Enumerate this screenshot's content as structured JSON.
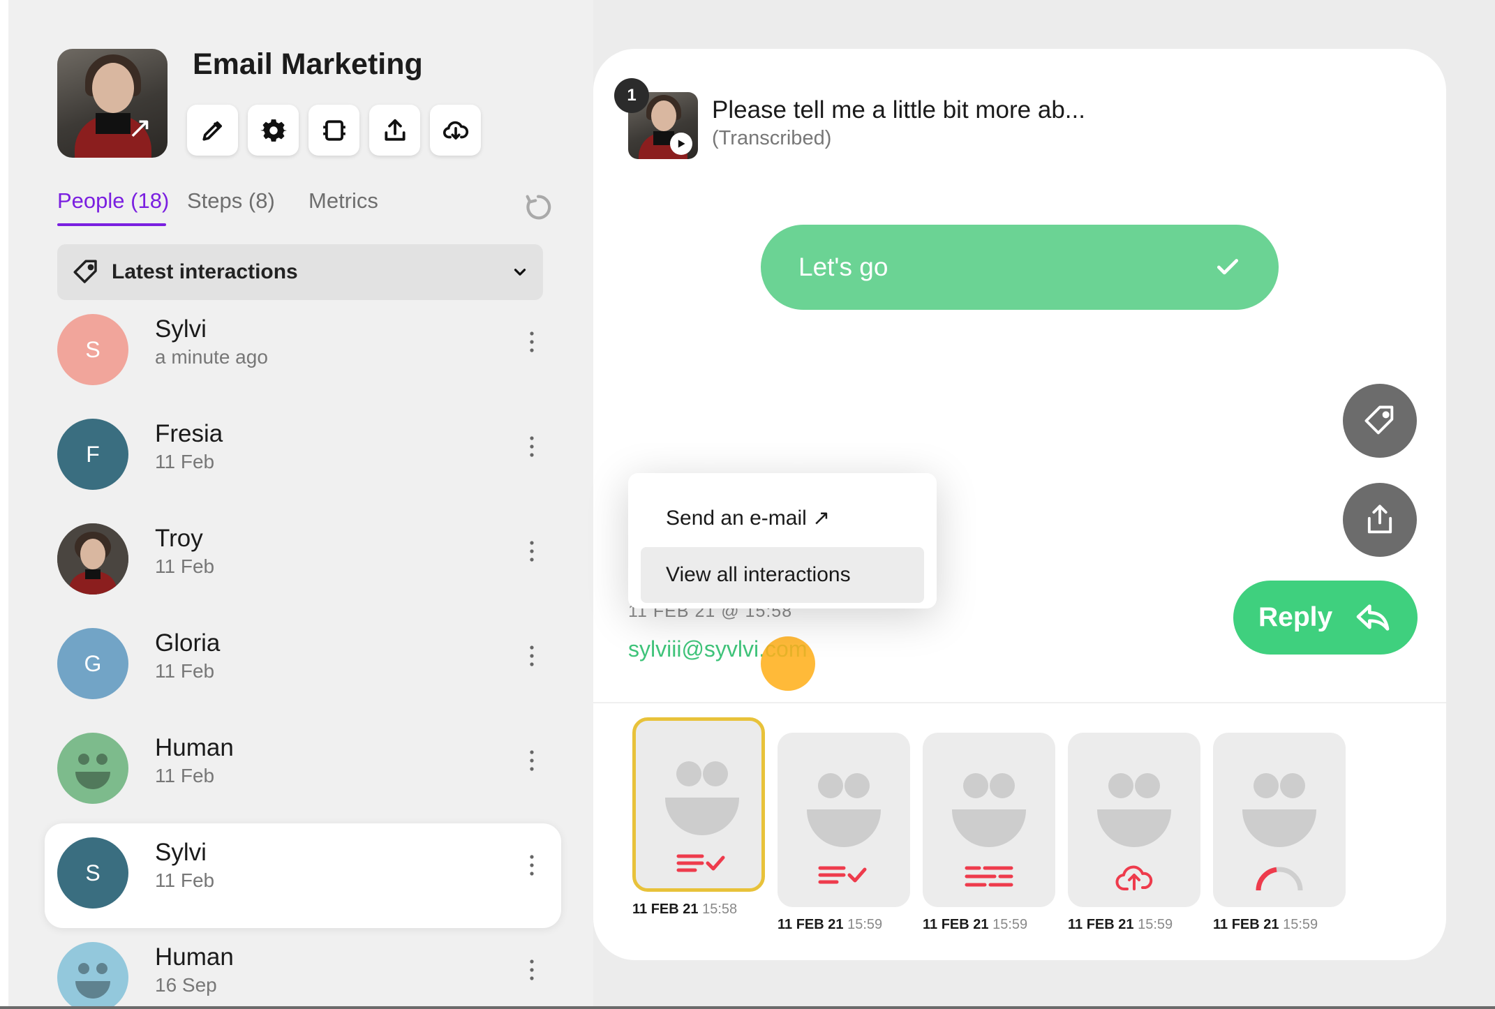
{
  "project": {
    "title": "Email Marketing",
    "thumb_icon": "open-external-arrow-icon",
    "thumb_arrow_glyph": "↗",
    "tools": [
      "pencil-icon",
      "gear-icon",
      "trim-icon",
      "upload-icon",
      "cloud-download-icon"
    ]
  },
  "tabs": [
    {
      "label": "People (18)",
      "active": true
    },
    {
      "label": "Steps (8)",
      "active": false
    },
    {
      "label": "Metrics",
      "active": false
    }
  ],
  "filter": {
    "label": "Latest interactions",
    "icon": "tag-icon"
  },
  "people": [
    {
      "name": "Sylvi",
      "when": "a minute ago",
      "initial": "S",
      "avatar": "letter",
      "color": "#f1a59b"
    },
    {
      "name": "Fresia",
      "when": "11 Feb",
      "initial": "F",
      "avatar": "letter",
      "color": "#3a6e80"
    },
    {
      "name": "Troy",
      "when": "11 Feb",
      "initial": "",
      "avatar": "photo",
      "color": "#4a4540"
    },
    {
      "name": "Gloria",
      "when": "11 Feb",
      "initial": "G",
      "avatar": "letter",
      "color": "#72a4c6"
    },
    {
      "name": "Human",
      "when": "11 Feb",
      "initial": "",
      "avatar": "smiley",
      "color": "#7dbb8c"
    },
    {
      "name": "Sylvi",
      "when": "11 Feb",
      "initial": "S",
      "avatar": "letter",
      "color": "#3a6e80",
      "selected": true
    },
    {
      "name": "Human",
      "when": "16 Sep",
      "initial": "",
      "avatar": "smiley",
      "color": "#93c8dc"
    }
  ],
  "question": {
    "number": "1",
    "text": "Please tell me a little bit more ab...",
    "subtext": "(Transcribed)"
  },
  "answer": {
    "label": "Let's go",
    "icon": "check-icon"
  },
  "popup": {
    "send_email": "Send an e-mail ↗",
    "view_all": "View all interactions"
  },
  "contact": {
    "datetime": "11 FEB 21 @ 15:58",
    "email": "sylviii@syvlvi.com"
  },
  "actions": {
    "reply_label": "Reply",
    "reply_icon": "reply-arrow-icon",
    "tag_icon": "tag-icon",
    "share_icon": "share-icon"
  },
  "responses": [
    {
      "date": "11 FEB 21",
      "time": "15:58",
      "status_icon": "text-check-icon",
      "active": true
    },
    {
      "date": "11 FEB 21",
      "time": "15:59",
      "status_icon": "text-check-icon",
      "active": false
    },
    {
      "date": "11 FEB 21",
      "time": "15:59",
      "status_icon": "text-lines-icon",
      "active": false
    },
    {
      "date": "11 FEB 21",
      "time": "15:59",
      "status_icon": "cloud-upload-icon",
      "active": false
    },
    {
      "date": "11 FEB 21",
      "time": "15:59",
      "status_icon": "progress-arc-icon",
      "active": false
    }
  ],
  "colors": {
    "accent_purple": "#7a1fe0",
    "green": "#3fd07e",
    "answer_green": "#6bd394",
    "status_red": "#ee3b4c",
    "fab_gray": "#6c6c6c"
  }
}
